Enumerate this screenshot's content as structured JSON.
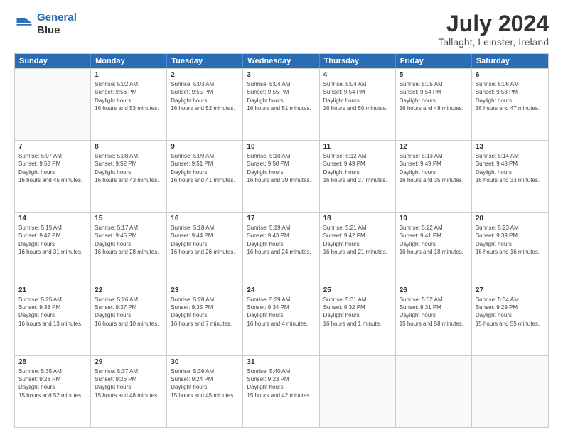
{
  "logo": {
    "line1": "General",
    "line2": "Blue"
  },
  "title": "July 2024",
  "subtitle": "Tallaght, Leinster, Ireland",
  "headers": [
    "Sunday",
    "Monday",
    "Tuesday",
    "Wednesday",
    "Thursday",
    "Friday",
    "Saturday"
  ],
  "rows": [
    [
      {
        "day": "",
        "sunrise": "",
        "sunset": "",
        "daylight": ""
      },
      {
        "day": "1",
        "sunrise": "5:02 AM",
        "sunset": "9:56 PM",
        "daylight": "16 hours and 53 minutes."
      },
      {
        "day": "2",
        "sunrise": "5:03 AM",
        "sunset": "9:55 PM",
        "daylight": "16 hours and 52 minutes."
      },
      {
        "day": "3",
        "sunrise": "5:04 AM",
        "sunset": "9:55 PM",
        "daylight": "16 hours and 51 minutes."
      },
      {
        "day": "4",
        "sunrise": "5:04 AM",
        "sunset": "9:54 PM",
        "daylight": "16 hours and 50 minutes."
      },
      {
        "day": "5",
        "sunrise": "5:05 AM",
        "sunset": "9:54 PM",
        "daylight": "16 hours and 48 minutes."
      },
      {
        "day": "6",
        "sunrise": "5:06 AM",
        "sunset": "9:53 PM",
        "daylight": "16 hours and 47 minutes."
      }
    ],
    [
      {
        "day": "7",
        "sunrise": "5:07 AM",
        "sunset": "9:53 PM",
        "daylight": "16 hours and 45 minutes."
      },
      {
        "day": "8",
        "sunrise": "5:08 AM",
        "sunset": "9:52 PM",
        "daylight": "16 hours and 43 minutes."
      },
      {
        "day": "9",
        "sunrise": "5:09 AM",
        "sunset": "9:51 PM",
        "daylight": "16 hours and 41 minutes."
      },
      {
        "day": "10",
        "sunrise": "5:10 AM",
        "sunset": "9:50 PM",
        "daylight": "16 hours and 39 minutes."
      },
      {
        "day": "11",
        "sunrise": "5:12 AM",
        "sunset": "9:49 PM",
        "daylight": "16 hours and 37 minutes."
      },
      {
        "day": "12",
        "sunrise": "5:13 AM",
        "sunset": "9:49 PM",
        "daylight": "16 hours and 35 minutes."
      },
      {
        "day": "13",
        "sunrise": "5:14 AM",
        "sunset": "9:48 PM",
        "daylight": "16 hours and 33 minutes."
      }
    ],
    [
      {
        "day": "14",
        "sunrise": "5:15 AM",
        "sunset": "9:47 PM",
        "daylight": "16 hours and 31 minutes."
      },
      {
        "day": "15",
        "sunrise": "5:17 AM",
        "sunset": "9:45 PM",
        "daylight": "16 hours and 28 minutes."
      },
      {
        "day": "16",
        "sunrise": "5:18 AM",
        "sunset": "9:44 PM",
        "daylight": "16 hours and 26 minutes."
      },
      {
        "day": "17",
        "sunrise": "5:19 AM",
        "sunset": "9:43 PM",
        "daylight": "16 hours and 24 minutes."
      },
      {
        "day": "18",
        "sunrise": "5:21 AM",
        "sunset": "9:42 PM",
        "daylight": "16 hours and 21 minutes."
      },
      {
        "day": "19",
        "sunrise": "5:22 AM",
        "sunset": "9:41 PM",
        "daylight": "16 hours and 18 minutes."
      },
      {
        "day": "20",
        "sunrise": "5:23 AM",
        "sunset": "9:39 PM",
        "daylight": "16 hours and 16 minutes."
      }
    ],
    [
      {
        "day": "21",
        "sunrise": "5:25 AM",
        "sunset": "9:38 PM",
        "daylight": "16 hours and 13 minutes."
      },
      {
        "day": "22",
        "sunrise": "5:26 AM",
        "sunset": "9:37 PM",
        "daylight": "16 hours and 10 minutes."
      },
      {
        "day": "23",
        "sunrise": "5:28 AM",
        "sunset": "9:35 PM",
        "daylight": "16 hours and 7 minutes."
      },
      {
        "day": "24",
        "sunrise": "5:29 AM",
        "sunset": "9:34 PM",
        "daylight": "16 hours and 4 minutes."
      },
      {
        "day": "25",
        "sunrise": "5:31 AM",
        "sunset": "9:32 PM",
        "daylight": "16 hours and 1 minute."
      },
      {
        "day": "26",
        "sunrise": "5:32 AM",
        "sunset": "9:31 PM",
        "daylight": "15 hours and 58 minutes."
      },
      {
        "day": "27",
        "sunrise": "5:34 AM",
        "sunset": "9:29 PM",
        "daylight": "15 hours and 55 minutes."
      }
    ],
    [
      {
        "day": "28",
        "sunrise": "5:35 AM",
        "sunset": "9:28 PM",
        "daylight": "15 hours and 52 minutes."
      },
      {
        "day": "29",
        "sunrise": "5:37 AM",
        "sunset": "9:26 PM",
        "daylight": "15 hours and 48 minutes."
      },
      {
        "day": "30",
        "sunrise": "5:39 AM",
        "sunset": "9:24 PM",
        "daylight": "15 hours and 45 minutes."
      },
      {
        "day": "31",
        "sunrise": "5:40 AM",
        "sunset": "9:23 PM",
        "daylight": "15 hours and 42 minutes."
      },
      {
        "day": "",
        "sunrise": "",
        "sunset": "",
        "daylight": ""
      },
      {
        "day": "",
        "sunrise": "",
        "sunset": "",
        "daylight": ""
      },
      {
        "day": "",
        "sunrise": "",
        "sunset": "",
        "daylight": ""
      }
    ]
  ]
}
